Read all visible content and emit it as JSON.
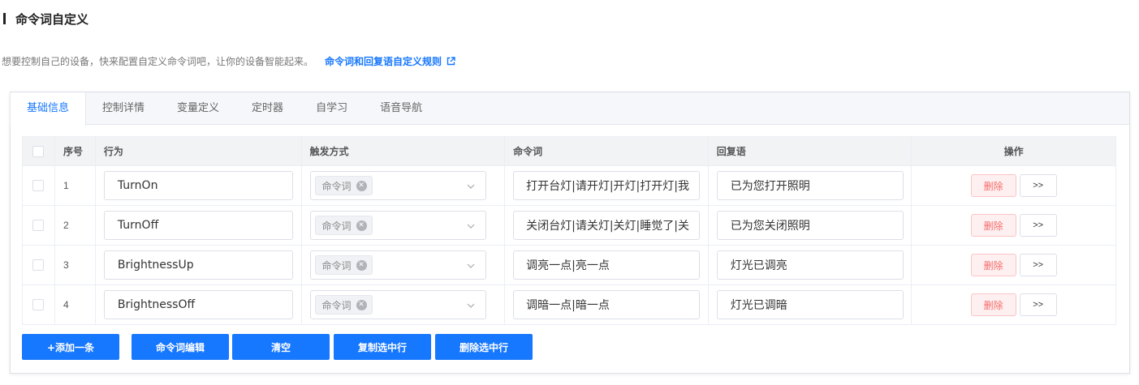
{
  "header": {
    "title": "命令词自定义",
    "description": "想要控制自己的设备，快来配置自定义命令词吧，让你的设备智能起来。",
    "rules_link": "命令词和回复语自定义规则"
  },
  "tabs": [
    {
      "label": "基础信息",
      "active": true
    },
    {
      "label": "控制详情",
      "active": false
    },
    {
      "label": "变量定义",
      "active": false
    },
    {
      "label": "定时器",
      "active": false
    },
    {
      "label": "自学习",
      "active": false
    },
    {
      "label": "语音导航",
      "active": false
    }
  ],
  "table": {
    "columns": {
      "index": "序号",
      "action": "行为",
      "trigger": "触发方式",
      "command": "命令词",
      "reply": "回复语",
      "operations": "操作"
    },
    "rows": [
      {
        "index": "1",
        "action": "TurnOn",
        "trigger_tag": "命令词",
        "command": "打开台灯|请开灯|开灯|打开灯|我",
        "reply": "已为您打开照明",
        "delete": "删除",
        "more": ">>"
      },
      {
        "index": "2",
        "action": "TurnOff",
        "trigger_tag": "命令词",
        "command": "关闭台灯|请关灯|关灯|睡觉了|关",
        "reply": "已为您关闭照明",
        "delete": "删除",
        "more": ">>"
      },
      {
        "index": "3",
        "action": "BrightnessUp",
        "trigger_tag": "命令词",
        "command": "调亮一点|亮一点",
        "reply": "灯光已调亮",
        "delete": "删除",
        "more": ">>"
      },
      {
        "index": "4",
        "action": "BrightnessOff",
        "trigger_tag": "命令词",
        "command": "调暗一点|暗一点",
        "reply": "灯光已调暗",
        "delete": "删除",
        "more": ">>"
      }
    ]
  },
  "actions": {
    "add": "+添加一条",
    "edit_commands": "命令词编辑",
    "clear": "清空",
    "copy_selected": "复制选中行",
    "delete_selected": "删除选中行"
  },
  "colors": {
    "accent": "#1677ff",
    "danger": "#f56c6c"
  }
}
